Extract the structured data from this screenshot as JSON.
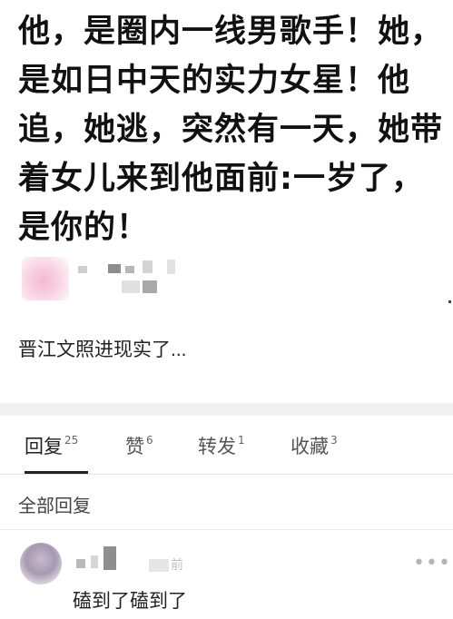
{
  "post": {
    "title": "他，是圈内一线男歌手！她，是如日中天的实力女星！他追，她逃，突然有一天，她带着女儿来到他面前:一岁了，是你的！",
    "excerpt": "晋江文照进现实了..."
  },
  "tabs": [
    {
      "label": "回复",
      "count": "25",
      "active": true
    },
    {
      "label": "赞",
      "count": "6",
      "active": false
    },
    {
      "label": "转发",
      "count": "1",
      "active": false
    },
    {
      "label": "收藏",
      "count": "3",
      "active": false
    }
  ],
  "replies_section": {
    "title": "全部回复"
  },
  "replies": [
    {
      "time_suffix": "前",
      "text": "磕到了磕到了",
      "more_label": "•••"
    }
  ]
}
